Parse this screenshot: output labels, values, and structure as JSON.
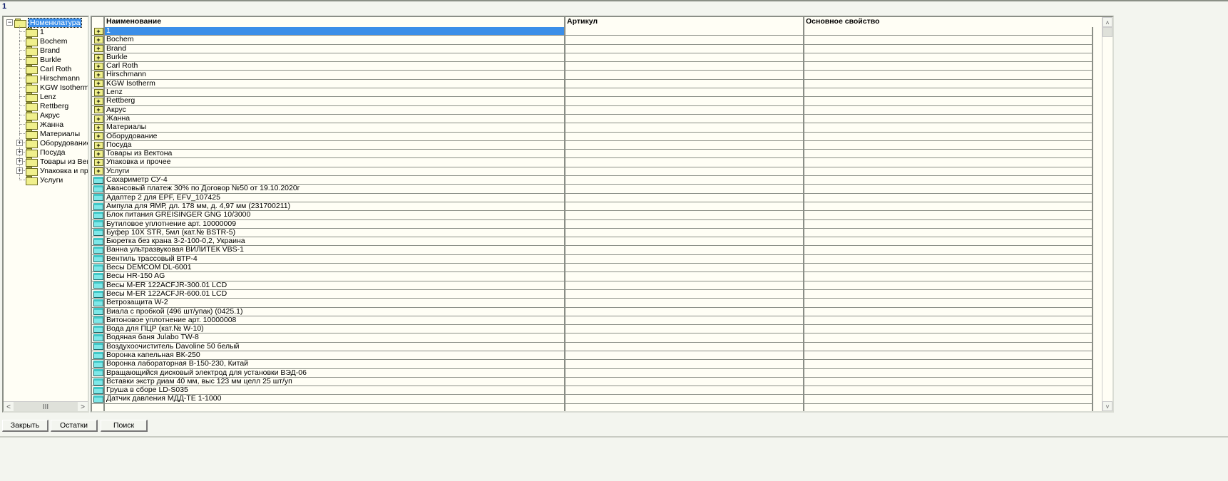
{
  "window": {
    "title": "1"
  },
  "tree": {
    "root": "Номенклатура",
    "items": [
      {
        "label": "1",
        "expandable": false
      },
      {
        "label": "Bochem",
        "expandable": false
      },
      {
        "label": "Brand",
        "expandable": false
      },
      {
        "label": "Burkle",
        "expandable": false
      },
      {
        "label": "Carl Roth",
        "expandable": false
      },
      {
        "label": "Hirschmann",
        "expandable": false
      },
      {
        "label": "KGW Isotherm",
        "expandable": false
      },
      {
        "label": "Lenz",
        "expandable": false
      },
      {
        "label": "Rettberg",
        "expandable": false
      },
      {
        "label": "Акрус",
        "expandable": false
      },
      {
        "label": "Жанна",
        "expandable": false
      },
      {
        "label": "Материалы",
        "expandable": false
      },
      {
        "label": "Оборудование",
        "expandable": true
      },
      {
        "label": "Посуда",
        "expandable": true
      },
      {
        "label": "Товары из Вект",
        "expandable": true
      },
      {
        "label": "Упаковка и проч",
        "expandable": true
      },
      {
        "label": "Услуги",
        "expandable": false
      }
    ],
    "scroll_left": "<",
    "scroll_thumb": "III",
    "scroll_right": ">"
  },
  "grid": {
    "columns": [
      "Наименование",
      "Артикул",
      "Основное свойство"
    ],
    "rows": [
      {
        "name": "1",
        "type": "group"
      },
      {
        "name": "Bochem",
        "type": "group"
      },
      {
        "name": "Brand",
        "type": "group"
      },
      {
        "name": "Burkle",
        "type": "group"
      },
      {
        "name": "Carl Roth",
        "type": "group"
      },
      {
        "name": "Hirschmann",
        "type": "group"
      },
      {
        "name": "KGW Isotherm",
        "type": "group"
      },
      {
        "name": "Lenz",
        "type": "group"
      },
      {
        "name": "Rettberg",
        "type": "group"
      },
      {
        "name": "Акрус",
        "type": "group"
      },
      {
        "name": "Жанна",
        "type": "group"
      },
      {
        "name": "Материалы",
        "type": "group"
      },
      {
        "name": "Оборудование",
        "type": "group"
      },
      {
        "name": "Посуда",
        "type": "group"
      },
      {
        "name": "Товары из Вектона",
        "type": "group"
      },
      {
        "name": "Упаковка и прочее",
        "type": "group"
      },
      {
        "name": "Услуги",
        "type": "group"
      },
      {
        "name": "Сахариметр СУ-4",
        "type": "item"
      },
      {
        "name": "Авансовый платеж 30% по Договор №50 от 19.10.2020г",
        "type": "item"
      },
      {
        "name": "Адаптер 2 для EPF, EFV_107425",
        "type": "item"
      },
      {
        "name": "Ампула для ЯМР, дл. 178 мм, д. 4,97 мм (231700211)",
        "type": "item"
      },
      {
        "name": "Блок питания GREISINGER GNG 10/3000",
        "type": "item"
      },
      {
        "name": "Бутиловое уплотнение арт. 10000009",
        "type": "item"
      },
      {
        "name": "Буфер 10X STR, 5мл (кат.№ BSTR-5)",
        "type": "item"
      },
      {
        "name": "Бюретка без крана 3-2-100-0,2, Украина",
        "type": "item"
      },
      {
        "name": "Ванна ультразвуковая ВИЛИТЕК VBS-1",
        "type": "item"
      },
      {
        "name": "Вентиль трассовый ВТР-4",
        "type": "item"
      },
      {
        "name": "Весы DEMCOM DL-6001",
        "type": "item"
      },
      {
        "name": "Весы HR-150 AG",
        "type": "item"
      },
      {
        "name": "Весы M-ER 122ACFJR-300.01 LCD",
        "type": "item"
      },
      {
        "name": "Весы M-ER 122ACFJR-600.01 LCD",
        "type": "item"
      },
      {
        "name": "Ветрозащита W-2",
        "type": "item"
      },
      {
        "name": "Виала с пробкой (496 шт/упак) (0425.1)",
        "type": "item"
      },
      {
        "name": "Витоновое уплотнение арт. 10000008",
        "type": "item"
      },
      {
        "name": "Вода для ПЦР (кат.№ W-10)",
        "type": "item"
      },
      {
        "name": "Водяная баня Julabo TW-8",
        "type": "item"
      },
      {
        "name": "Воздухоочиститель Davoline 50 белый",
        "type": "item"
      },
      {
        "name": "Воронка капельная ВК-250",
        "type": "item"
      },
      {
        "name": "Воронка лабораторная В-150-230, Китай",
        "type": "item"
      },
      {
        "name": "Вращающийся дисковый электрод для установки ВЭД-06",
        "type": "item"
      },
      {
        "name": "Вставки экстр диам 40 мм, выс 123 мм целл 25 шт/уп",
        "type": "item"
      },
      {
        "name": "Груша в сборе LD-S035",
        "type": "item"
      },
      {
        "name": "Датчик давления МДД-ТЕ 1-1000",
        "type": "item"
      }
    ],
    "selected_index": 0
  },
  "buttons": {
    "close": "Закрыть",
    "stock": "Остатки",
    "search": "Поиск"
  },
  "colors": {
    "selection": "#3b8ee8",
    "background": "#f3f5ef",
    "grid_bg": "#fffef5"
  }
}
